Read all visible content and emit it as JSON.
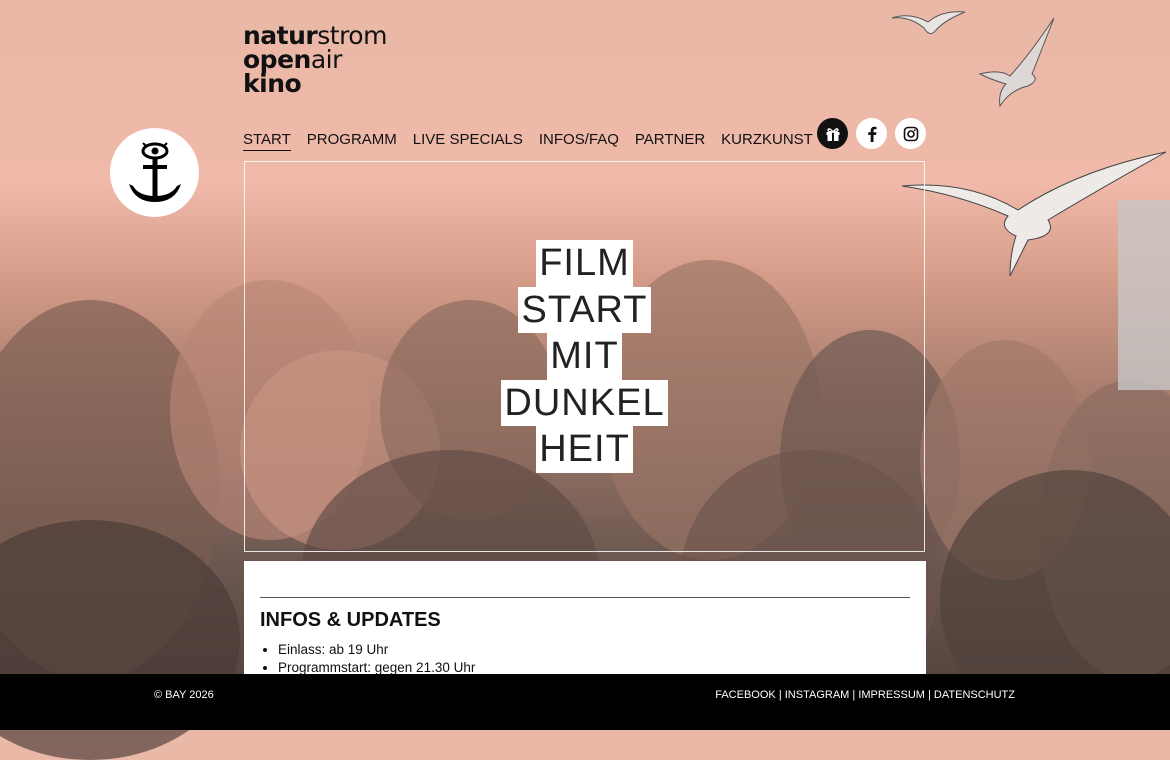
{
  "logo": {
    "line1_bold": "natur",
    "line1_light": "strom",
    "line2_bold": "open",
    "line2_light": "air",
    "line3_bold": "kino"
  },
  "nav": [
    {
      "label": "START",
      "active": true
    },
    {
      "label": "PROGRAMM"
    },
    {
      "label": "LIVE SPECIALS"
    },
    {
      "label": "INFOS/FAQ"
    },
    {
      "label": "PARTNER"
    },
    {
      "label": "KURZKUNST"
    }
  ],
  "social": [
    "gift-icon",
    "facebook-icon",
    "instagram-icon"
  ],
  "hero": {
    "lines": [
      "FILM",
      "START",
      "MIT",
      "DUNKEL",
      "HEIT"
    ]
  },
  "infos": {
    "title": "INFOS & UPDATES",
    "items": [
      "Einlass: ab 19 Uhr",
      "Programmstart: gegen 21.30 Uhr"
    ]
  },
  "footer": {
    "copyright": "© BAY 2026",
    "links": [
      "FACEBOOK",
      "INSTAGRAM",
      "IMPRESSUM",
      "DATENSCHUTZ"
    ],
    "separator": " | "
  },
  "colors": {
    "sky": "#f0b9a9",
    "footer_bg": "#000000",
    "accent": "#111111"
  }
}
